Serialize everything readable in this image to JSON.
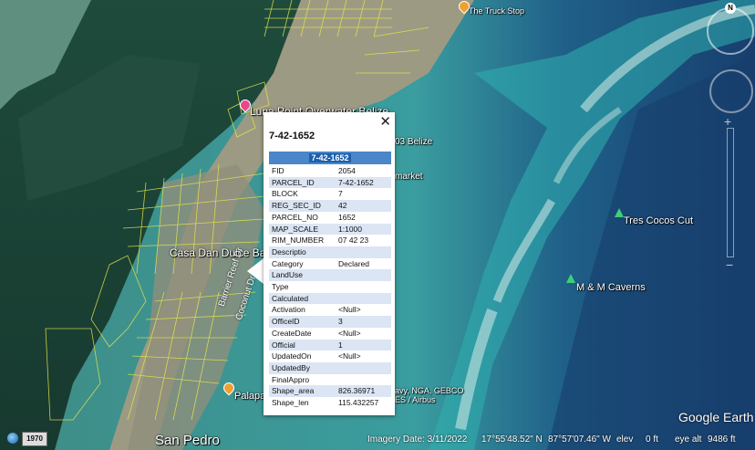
{
  "map": {
    "places": [
      {
        "name": "Luna Point Overwater Belize",
        "pin_color": "#e8478a"
      },
      {
        "name": "Casa Dan Dulce Bake",
        "pin_color": null
      },
      {
        "name": "Tres Cocos Cut",
        "pin_color": "#3ecf7a"
      },
      {
        "name": "M & M Caverns",
        "pin_color": "#3ecf7a"
      },
      {
        "name": "Palapa",
        "pin_color": "#f0a030"
      },
      {
        "name": "San Pedro",
        "pin_color": null
      },
      {
        "name": "The Truck Stop",
        "pin_color": "#f0a030"
      },
      {
        "name": "03 Belize",
        "pin_color": null
      },
      {
        "name": "market",
        "pin_color": null
      }
    ],
    "roads": [
      "Barrier Reef Dr",
      "Coconut Dr"
    ],
    "overlay_attribution": "avy, NGA, GEBCO\nES / Airbus"
  },
  "popup": {
    "title": "7-42-1652",
    "header": "7-42-1652",
    "close_label": "✕",
    "rows": [
      {
        "key": "FID",
        "value": "2054"
      },
      {
        "key": "PARCEL_ID",
        "value": "7-42-1652"
      },
      {
        "key": "BLOCK",
        "value": "7"
      },
      {
        "key": "REG_SEC_ID",
        "value": "42"
      },
      {
        "key": "PARCEL_NO",
        "value": "1652"
      },
      {
        "key": "MAP_SCALE",
        "value": "1:1000"
      },
      {
        "key": "RIM_NUMBER",
        "value": "07 42 23"
      },
      {
        "key": "Descriptio",
        "value": ""
      },
      {
        "key": "Category",
        "value": "Declared"
      },
      {
        "key": "LandUse",
        "value": ""
      },
      {
        "key": "Type",
        "value": ""
      },
      {
        "key": "Calculated",
        "value": ""
      },
      {
        "key": "Activation",
        "value": "<Null>"
      },
      {
        "key": "OfficeID",
        "value": "3"
      },
      {
        "key": "CreateDate",
        "value": "<Null>"
      },
      {
        "key": "Official",
        "value": "1"
      },
      {
        "key": "UpdatedOn",
        "value": "<Null>"
      },
      {
        "key": "UpdatedBy",
        "value": ""
      },
      {
        "key": "FinalAppro",
        "value": ""
      },
      {
        "key": "Shape_area",
        "value": "826.36971"
      },
      {
        "key": "Shape_len",
        "value": "115.432257"
      }
    ]
  },
  "status_bar": {
    "year": "1970",
    "imagery_date": "Imagery Date: 3/11/2022",
    "lat": "17°55'48.52\" N",
    "lon": "87°57'07.46\" W",
    "elev_label": "elev",
    "elev_value": "0 ft",
    "eye_alt_label": "eye alt",
    "eye_alt_value": "9486 ft"
  },
  "brand": "Google Earth",
  "compass_north": "N",
  "icons": [
    "globe-icon",
    "compass-icon",
    "close-icon",
    "place-pin-icon",
    "dive-site-icon"
  ]
}
